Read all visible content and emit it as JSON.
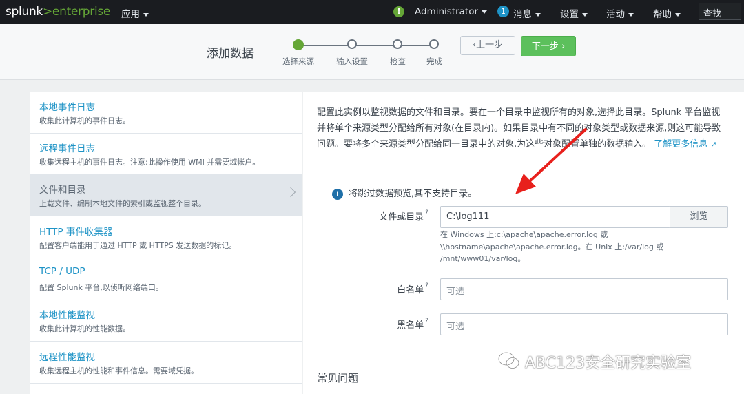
{
  "topbar": {
    "logo_splunk": "splunk",
    "logo_gt": ">",
    "logo_enterprise": "enterprise",
    "apps": "应用",
    "status_icon": "!",
    "user": "Administrator",
    "messages_count": "1",
    "messages": "消息",
    "settings": "设置",
    "activity": "活动",
    "help": "帮助",
    "search": "查找"
  },
  "header": {
    "title": "添加数据",
    "steps": [
      "选择来源",
      "输入设置",
      "检查",
      "完成"
    ],
    "prev_label": "上一步",
    "next_label": "下一步"
  },
  "sidebar": {
    "items": [
      {
        "title": "本地事件日志",
        "desc": "收集此计算机的事件日志。"
      },
      {
        "title": "远程事件日志",
        "desc": "收集远程主机的事件日志。注意:此操作使用 WMI 并需要域帐户。"
      },
      {
        "title": "文件和目录",
        "desc": "上载文件、编制本地文件的索引或监视整个目录。"
      },
      {
        "title": "HTTP 事件收集器",
        "desc": "配置客户端能用于通过 HTTP 或 HTTPS 发送数据的标记。"
      },
      {
        "title": "TCP / UDP",
        "desc": "配置 Splunk 平台,以侦听网络端口。"
      },
      {
        "title": "本地性能监视",
        "desc": "收集此计算机的性能数据。"
      },
      {
        "title": "远程性能监视",
        "desc": "收集远程主机的性能和事件信息。需要域凭据。"
      }
    ]
  },
  "main": {
    "description": "配置此实例以监视数据的文件和目录。要在一个目录中监视所有的对象,选择此目录。Splunk 平台监视并将单个来源类型分配给所有对象(在目录内)。如果目录中有不同的对象类型或数据来源,则这可能导致问题。要将多个来源类型分配给同一目录中的对象,为这些对象配置单独的数据输入。",
    "learn_more": "了解更多信息",
    "info": "将跳过数据预览,其不支持目录。",
    "file_label": "文件或目录",
    "file_value": "C:\\log111",
    "browse": "浏览",
    "help_text": "在 Windows 上:c:\\apache\\apache.error.log 或 \\\\hostname\\apache\\apache.error.log。在 Unix 上:/var/log 或 /mnt/www01/var/log。",
    "whitelist_label": "白名单",
    "whitelist_placeholder": "可选",
    "blacklist_label": "黑名单",
    "blacklist_placeholder": "可选",
    "faq": "常见问题",
    "question_mark": "?"
  },
  "watermark": "ABC123安全研究实验室",
  "colors": {
    "accent": "#65a637",
    "link": "#1e93c6",
    "next_button": "#5cc05c",
    "arrow": "#e8201c"
  }
}
